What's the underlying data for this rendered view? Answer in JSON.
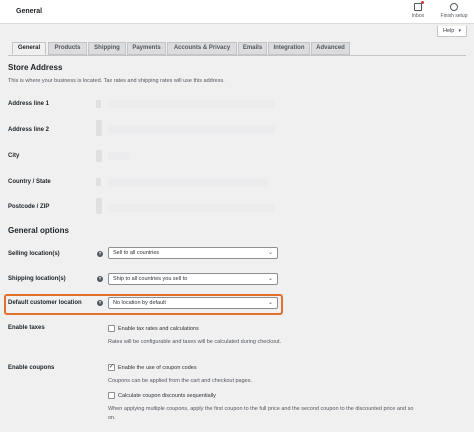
{
  "header": {
    "title": "General",
    "inbox_label": "Inbox",
    "finish_setup_label": "Finish setup",
    "help_label": "Help"
  },
  "tabs": [
    {
      "label": "General",
      "active": true
    },
    {
      "label": "Products"
    },
    {
      "label": "Shipping"
    },
    {
      "label": "Payments"
    },
    {
      "label": "Accounts & Privacy"
    },
    {
      "label": "Emails"
    },
    {
      "label": "Integration"
    },
    {
      "label": "Advanced"
    }
  ],
  "store_address": {
    "heading": "Store Address",
    "description": "This is where your business is located. Tax rates and shipping rates will use this address.",
    "fields": [
      {
        "label": "Address line 1"
      },
      {
        "label": "Address line 2"
      },
      {
        "label": "City"
      },
      {
        "label": "Country / State"
      },
      {
        "label": "Postcode / ZIP"
      }
    ]
  },
  "general_options": {
    "heading": "General options",
    "selling_locations": {
      "label": "Selling location(s)",
      "value": "Sell to all countries"
    },
    "shipping_locations": {
      "label": "Shipping location(s)",
      "value": "Ship to all countries you sell to"
    },
    "default_customer_location": {
      "label": "Default customer location",
      "value": "No location by default"
    },
    "enable_taxes": {
      "label": "Enable taxes",
      "checkbox_label": "Enable tax rates and calculations",
      "checked": false,
      "help": "Rates will be configurable and taxes will be calculated during checkout."
    },
    "enable_coupons": {
      "label": "Enable coupons",
      "checkbox_label": "Enable the use of coupon codes",
      "checked": true,
      "help": "Coupons can be applied from the cart and checkout pages.",
      "sequential_label": "Calculate coupon discounts sequentially",
      "sequential_checked": false,
      "sequential_help_1": "When applying multiple coupons, apply the first coupon to the full price and the second coupon to the discounted price and so",
      "sequential_help_2": "on."
    }
  },
  "colors": {
    "highlight": "#e26f2c",
    "background": "#f0f0f1"
  }
}
